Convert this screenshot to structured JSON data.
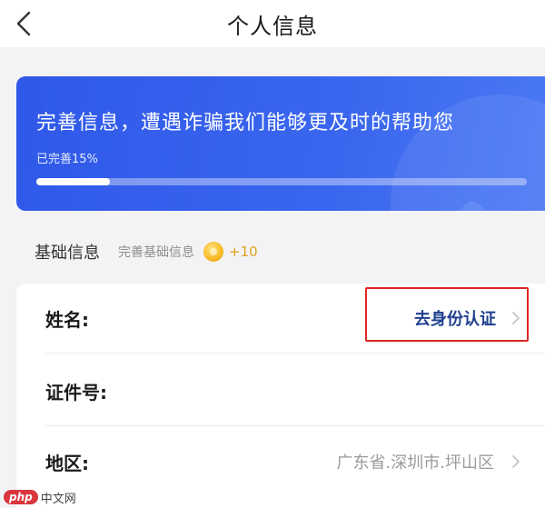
{
  "header": {
    "title": "个人信息",
    "back_icon": "chevron-left-icon"
  },
  "banner": {
    "title": "完善信息，遭遇诈骗我们能够更及时的帮助您",
    "progress_text": "已完善15%",
    "progress": 0.15,
    "colors": {
      "start": "#2f58e8",
      "end": "#4b78f3"
    }
  },
  "section": {
    "title": "基础信息",
    "subtitle": "完善基础信息",
    "reward": "+10",
    "reward_icon": "coin-icon"
  },
  "rows": [
    {
      "label": "姓名:",
      "action": "去身份认证"
    },
    {
      "label": "证件号:",
      "value": ""
    },
    {
      "label": "地区:",
      "value": "广东省.深圳市.坪山区"
    }
  ],
  "watermark": {
    "badge": "php",
    "text": "中文网"
  }
}
